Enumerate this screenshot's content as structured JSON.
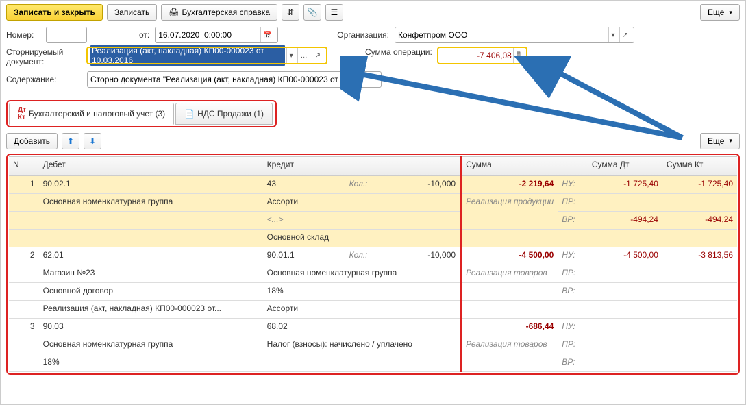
{
  "toolbar": {
    "save_close": "Записать и закрыть",
    "save": "Записать",
    "report": "Бухгалтерская справка",
    "more": "Еще"
  },
  "form": {
    "number_label": "Номер:",
    "number_value": "",
    "date_label": "от:",
    "date_value": "16.07.2020  0:00:00",
    "org_label": "Организация:",
    "org_value": "Конфетпром ООО",
    "storno_label": "Сторнируемый документ:",
    "storno_value": "Реализация (акт, накладная) КП00-000023 от 10.03.2016",
    "sum_label": "Сумма операции:",
    "sum_value": "-7 406,08",
    "content_label": "Содержание:",
    "content_value": "Сторно документа \"Реализация (акт, накладная) КП00-000023 от 10"
  },
  "tabs": {
    "t1": "Бухгалтерский и налоговый учет (3)",
    "t2": "НДС Продажи (1)"
  },
  "midbar": {
    "add": "Добавить",
    "more": "Еще"
  },
  "grid": {
    "headers": {
      "n": "N",
      "debit": "Дебет",
      "credit": "Кредит",
      "sum": "Сумма",
      "sum_dt": "Сумма Дт",
      "sum_kt": "Сумма Кт"
    },
    "rows": [
      {
        "n": "1",
        "debit_acc": "90.02.1",
        "debit_sub1": "Основная номенклатурная группа",
        "credit_acc": "43",
        "credit_sub1": "Ассорти",
        "credit_sub2": "<...>",
        "credit_sub3": "Основной склад",
        "qty_label": "Кол.:",
        "qty": "-10,000",
        "sum": "-2 219,64",
        "sum_desc": "Реализация продукции",
        "nu": "НУ:",
        "nu_dt": "-1 725,40",
        "nu_kt": "-1 725,40",
        "pr": "ПР:",
        "vr": "ВР:",
        "vr_dt": "-494,24",
        "vr_kt": "-494,24"
      },
      {
        "n": "2",
        "debit_acc": "62.01",
        "debit_sub1": "Магазин №23",
        "debit_sub2": "Основной договор",
        "debit_sub3": "Реализация (акт, накладная) КП00-000023 от...",
        "credit_acc": "90.01.1",
        "credit_sub1": "Основная номенклатурная группа",
        "credit_sub2": "18%",
        "credit_sub3": "Ассорти",
        "qty_label": "Кол.:",
        "qty": "-10,000",
        "sum": "-4 500,00",
        "sum_desc": "Реализация товаров",
        "nu": "НУ:",
        "nu_dt": "-4 500,00",
        "nu_kt": "-3 813,56",
        "pr": "ПР:",
        "vr": "ВР:"
      },
      {
        "n": "3",
        "debit_acc": "90.03",
        "debit_sub1": "Основная номенклатурная группа",
        "debit_sub2": "18%",
        "credit_acc": "68.02",
        "credit_sub1": "Налог (взносы): начислено / уплачено",
        "sum": "-686,44",
        "sum_desc": "Реализация товаров",
        "nu": "НУ:",
        "pr": "ПР:",
        "vr": "ВР:"
      }
    ]
  }
}
